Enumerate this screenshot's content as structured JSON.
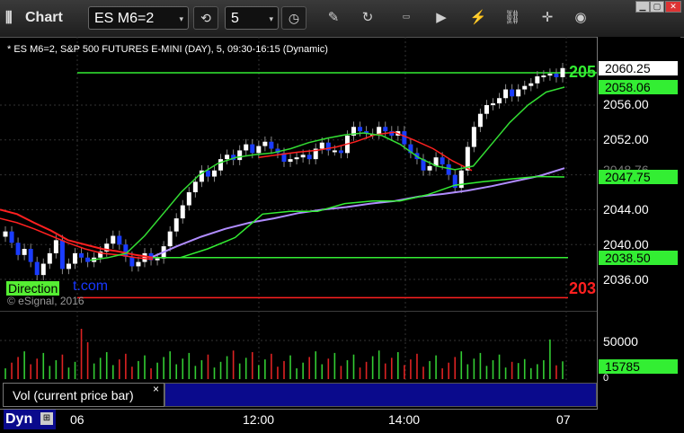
{
  "toolbar": {
    "app_title": "Chart",
    "symbol": "ES M6=2",
    "interval": "5"
  },
  "chart_header": "* ES M6=2, S&P 500 FUTURES E-MINI (DAY), 5, 09:30-16:15 (Dynamic)",
  "watermark": {
    "direction": "Direction",
    "site": "t.com",
    "copyright": "© eSignal, 2016"
  },
  "price_axis": {
    "ticks": [
      "2056.00",
      "2052.00",
      "2048.00",
      "2044.00",
      "2040.00",
      "2036.00"
    ],
    "current": "2060.25",
    "green_ma_value": "2058.06",
    "overlap_hidden": "2048.76",
    "level_mid": "2047.75",
    "level_low": "2038.50",
    "edge_top": "205",
    "edge_bottom": "203"
  },
  "volume_axis": {
    "tick": "50000",
    "zero": "0",
    "current": "15785"
  },
  "volume_label": "Vol (current price bar)",
  "close_mark": "×",
  "time_axis": {
    "labels": [
      "06",
      "12:00",
      "14:00",
      "07"
    ]
  },
  "dyn_label": "Dyn",
  "colors": {
    "up": "#ffffff",
    "down": "#1a3cff",
    "ma_fast": "#33dd33",
    "ma_red": "#ff2020",
    "ma_purple": "#b08cff",
    "level": "#33ee33"
  },
  "chart_data": {
    "type": "candlestick",
    "title": "ES M6=2, S&P 500 FUTURES E-MINI (DAY), 5, 09:30-16:15 (Dynamic)",
    "y_range": [
      2033,
      2062
    ],
    "x_labels": [
      "06",
      "12:00",
      "14:00",
      "07"
    ],
    "closes": [
      2041.5,
      2040.2,
      2038.8,
      2039.5,
      2038.0,
      2036.5,
      2037.8,
      2039.0,
      2040.5,
      2037.2,
      2037.8,
      2039.0,
      2038.5,
      2038.0,
      2038.5,
      2039.2,
      2040.1,
      2041.0,
      2040.0,
      2038.6,
      2037.5,
      2038.0,
      2039.0,
      2038.2,
      2038.4,
      2039.8,
      2041.5,
      2043.0,
      2044.5,
      2046.0,
      2047.2,
      2048.5,
      2047.8,
      2048.5,
      2049.8,
      2050.3,
      2049.7,
      2050.8,
      2051.5,
      2050.5,
      2051.3,
      2051.8,
      2051.0,
      2050.5,
      2049.5,
      2049.8,
      2050.0,
      2050.3,
      2049.8,
      2051.0,
      2051.7,
      2050.8,
      2050.8,
      2050.5,
      2052.5,
      2053.5,
      2053.0,
      2052.7,
      2052.7,
      2053.5,
      2053.0,
      2052.5,
      2053.0,
      2051.5,
      2050.5,
      2049.8,
      2048.5,
      2049.0,
      2050.0,
      2049.2,
      2048.0,
      2046.5,
      2048.5,
      2051.2,
      2053.5,
      2055.0,
      2056.0,
      2056.2,
      2056.8,
      2057.8,
      2057.0,
      2057.8,
      2058.2,
      2058.5,
      2059.3,
      2059.4,
      2059.6,
      2059.2,
      2060.25
    ],
    "ma_green_fast": [
      2038.2,
      2038.5,
      2039.0,
      2041.0,
      2043.5,
      2046.0,
      2048.0,
      2049.3,
      2050.0,
      2050.3,
      2050.5,
      2051.0,
      2051.7,
      2052.2,
      2052.6,
      2052.8,
      2052.5,
      2051.5,
      2050.0,
      2049.0,
      2048.6,
      2049.0,
      2051.5,
      2054.0,
      2056.0,
      2057.5,
      2058.06
    ],
    "ma_purple": [
      2038.6,
      2039.8,
      2040.9,
      2041.8,
      2042.5,
      2043.0,
      2043.6,
      2044.0,
      2044.3,
      2044.7,
      2045.0,
      2045.5,
      2045.8,
      2046.2,
      2046.7,
      2047.3,
      2047.9,
      2048.76
    ],
    "level_steps": [
      2038.5,
      2038.5,
      2039.5,
      2040.8,
      2043.5,
      2043.8,
      2043.8,
      2044.7,
      2045.0,
      2045.0,
      2045.7,
      2046.8,
      2047.2,
      2047.5,
      2047.8,
      2047.75
    ],
    "levels": [
      2038.5,
      2033.9
    ],
    "volume_max_tick": 50000,
    "volume_current": 15785
  }
}
